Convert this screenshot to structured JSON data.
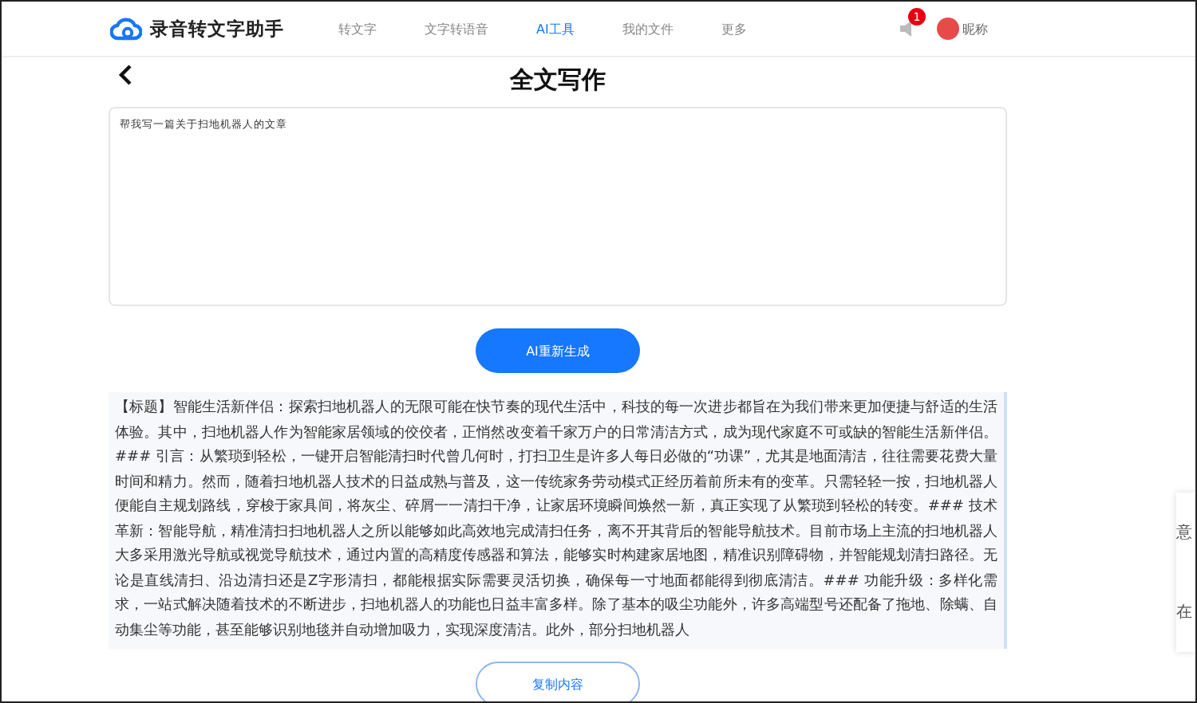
{
  "header": {
    "logo_text": "录音转文字助手",
    "nav": [
      {
        "label": "转文字",
        "selected": false
      },
      {
        "label": "文字转语音",
        "selected": false
      },
      {
        "label": "AI工具",
        "selected": true
      },
      {
        "label": "我的文件",
        "selected": false
      },
      {
        "label": "更多",
        "selected": false
      }
    ],
    "notification_count": "1",
    "username": "昵称"
  },
  "page": {
    "title": "全文写作"
  },
  "prompt": {
    "value": "帮我写一篇关于扫地机器人的文章"
  },
  "regenerate_button": "AI重新生成",
  "result": {
    "text": "【标题】智能生活新伴侣：探索扫地机器人的无限可能在快节奏的现代生活中，科技的每一次进步都旨在为我们带来更加便捷与舒适的生活体验。其中，扫地机器人作为智能家居领域的佼佼者，正悄然改变着千家万户的日常清洁方式，成为现代家庭不可或缺的智能生活新伴侣。### 引言：从繁琐到轻松，一键开启智能清扫时代曾几何时，打扫卫生是许多人每日必做的“功课”，尤其是地面清洁，往往需要花费大量时间和精力。然而，随着扫地机器人技术的日益成熟与普及，这一传统家务劳动模式正经历着前所未有的变革。只需轻轻一按，扫地机器人便能自主规划路线，穿梭于家具间，将灰尘、碎屑一一清扫干净，让家居环境瞬间焕然一新，真正实现了从繁琐到轻松的转变。### 技术革新：智能导航，精准清扫扫地机器人之所以能够如此高效地完成清扫任务，离不开其背后的智能导航技术。目前市场上主流的扫地机器人大多采用激光导航或视觉导航技术，通过内置的高精度传感器和算法，能够实时构建家居地图，精准识别障碍物，并智能规划清扫路径。无论是直线清扫、沿边清扫还是Z字形清扫，都能根据实际需要灵活切换，确保每一寸地面都能得到彻底清洁。### 功能升级：多样化需求，一站式解决随着技术的不断进步，扫地机器人的功能也日益丰富多样。除了基本的吸尘功能外，许多高端型号还配备了拖地、除螨、自动集尘等功能，甚至能够识别地毯并自动增加吸力，实现深度清洁。此外，部分扫地机器人"
  },
  "copy_button": "复制内容",
  "side_panel": {
    "texts": [
      "意",
      "在"
    ]
  }
}
